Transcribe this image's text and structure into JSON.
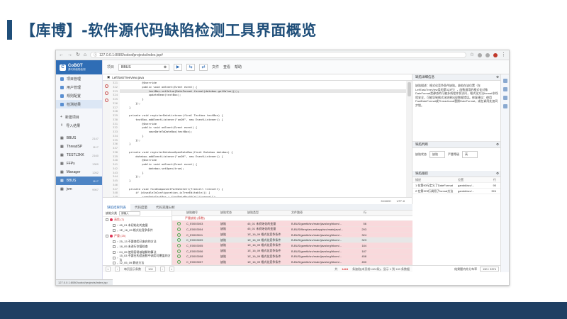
{
  "slide": {
    "title": "【库博】-软件源代码缺陷检测工具界面概览"
  },
  "browser": {
    "url": "127.0.0.1:8080/cobot/projects/index.jsp#",
    "status_url": "127.0.0.1:8080/cobot/projects/index.jsp"
  },
  "sidebar": {
    "logo": "CoBOT",
    "logo_sub": "源代码缺陷检测",
    "menu": [
      {
        "label": "项目管理",
        "active": false
      },
      {
        "label": "用户管理",
        "active": false
      },
      {
        "label": "规则配置",
        "active": false
      },
      {
        "label": "检测结果",
        "active": true
      }
    ],
    "actions": [
      {
        "label": "新建项目"
      },
      {
        "label": "导入结果"
      }
    ],
    "projects": [
      {
        "label": "BBUS",
        "count": "2147",
        "active": false
      },
      {
        "label": "ThreadSP",
        "count": "1117",
        "active": false
      },
      {
        "label": "TESTL2KK",
        "count": "2160",
        "active": false
      },
      {
        "label": "FFPs",
        "count": "1300",
        "active": false
      },
      {
        "label": "Manager",
        "count": "1262",
        "active": false
      },
      {
        "label": "BBUS",
        "count": "1117",
        "active": true
      },
      {
        "label": "jvm",
        "count": "9907",
        "active": false
      }
    ]
  },
  "toolbar": {
    "label": "项目",
    "search_value": "BBUS",
    "menu": [
      "文件",
      "查看",
      "帮助"
    ]
  },
  "editor": {
    "tab": "LeftTaskTreeView.java",
    "status_left": "334/690",
    "status_right": "UTF-8",
    "lines": [
      {
        "n": "321",
        "t": "            @Override",
        "hl": false
      },
      {
        "n": "322",
        "t": "            public void onEvent(Event event) {",
        "hl": false
      },
      {
        "n": "323",
        "t": "                textBox.setValue(DateFormat.format(datebox.getValue()));",
        "hl": true
      },
      {
        "n": "324",
        "t": "                updateBean(textBox);",
        "hl": false
      },
      {
        "n": "325",
        "t": "            }",
        "hl": false
      },
      {
        "n": "326",
        "t": "        });",
        "hl": false
      },
      {
        "n": "327",
        "t": "    }",
        "hl": false
      },
      {
        "n": "328",
        "t": "",
        "hl": false
      },
      {
        "n": "329",
        "t": "    private void registerDateListener(final Textbox textBox) {",
        "hl": false
      },
      {
        "n": "330",
        "t": "        textBox.addEventListener(\"onOK\", new EventListener() {",
        "hl": false
      },
      {
        "n": "331",
        "t": "            @Override",
        "hl": false
      },
      {
        "n": "332",
        "t": "            public void onEvent(Event event) {",
        "hl": false
      },
      {
        "n": "333",
        "t": "                saveDateToDateBox(textBox);",
        "hl": false
      },
      {
        "n": "334",
        "t": "            }",
        "hl": false
      },
      {
        "n": "335",
        "t": "        });",
        "hl": false
      },
      {
        "n": "336",
        "t": "    }",
        "hl": false
      },
      {
        "n": "337",
        "t": "",
        "hl": false
      },
      {
        "n": "338",
        "t": "    private void registerDateboxOpenDateBox(final Datebox datebox) {",
        "hl": false
      },
      {
        "n": "339",
        "t": "        datebox.addEventListener(\"onOK\", new EventListener() {",
        "hl": false
      },
      {
        "n": "340",
        "t": "            @Override",
        "hl": false
      },
      {
        "n": "341",
        "t": "            public void onEvent(Event event) {",
        "hl": false
      },
      {
        "n": "342",
        "t": "                datebox.setOpen(true);",
        "hl": false
      },
      {
        "n": "343",
        "t": "            }",
        "hl": false
      },
      {
        "n": "344",
        "t": "        });",
        "hl": false
      },
      {
        "n": "345",
        "t": "    }",
        "hl": false
      },
      {
        "n": "346",
        "t": "",
        "hl": false
      },
      {
        "n": "347",
        "t": "    private void findComponentForDateCell(Treecell treecell) {",
        "hl": false
      },
      {
        "n": "348",
        "t": "        if (disableInConfiguration.isTreeEditable()) {",
        "hl": false
      },
      {
        "n": "349",
        "t": "            crgeDateTextBox = findDateBoxOfCell(treecell);",
        "hl": false
      }
    ]
  },
  "right_panel": {
    "detail_title": "缺陷详细信息",
    "detail_text": "缺陷描述：格式化竞争条件缺陷。缺陷在该位置（在LeftTaskTreeView类的第323行），函数调用的格式化对象DateFormat是静态的可被多线程并发访问，格式化方法format非线程安全，可能导致格式化结果出现数据错误。修复建议：使用FastDateFormat或ThreadLocal替换DateFormat，或在调用处加同步锁。",
    "mark_title": "缺陷判断",
    "mark_label": "缺陷状态",
    "mark_value": "缺陷",
    "sev_label": "严重等级",
    "sev_value": "高",
    "trace_title": "缺陷跟踪",
    "trace_headers": [
      "描述",
      "位置",
      "行"
    ],
    "trace_rows": [
      {
        "desc": "1 在第90行定义了DateFormat",
        "loc": "gambk/src/...",
        "line": "90"
      },
      {
        "desc": "2 在第323行调用了format方法",
        "loc": "gambk/src/...",
        "line": "324"
      }
    ],
    "foot_label": "结果题内外分布率",
    "foot_value": "150 / 3374"
  },
  "bottom": {
    "tabs": [
      "缺陷结果列表",
      "代码度量",
      "代码克隆分析"
    ],
    "tree_header": "缺陷分类",
    "tree_filter": "请输入",
    "tree": [
      {
        "label": "高危 (7)",
        "level": 1
      },
      {
        "label": "45_01 未初始化的变量",
        "level": 2
      },
      {
        "label": "1E_16_09 格式化竞争条件",
        "level": 2
      },
      {
        "label": "严重 (25)",
        "level": 1
      },
      {
        "label": "25_13 不要使用已废弃的方法",
        "level": 2
      },
      {
        "label": "18_05 未进行空值检查",
        "level": 2
      },
      {
        "label": "04_05 使用容易被破解的算法",
        "level": 2
      },
      {
        "label": "15_03 不要在构造函数中调用可覆盖的方法",
        "level": 2
      },
      {
        "label": "12_05_09 静态方法",
        "level": 2
      },
      {
        "label": "中等 (133)",
        "level": 1
      }
    ],
    "grid_headers": [
      "缺陷编号",
      "缺陷状态",
      "缺陷类型",
      "文件路径",
      "行"
    ],
    "grid_group": "严重缺陷 (条数)",
    "grid_rows": [
      {
        "id": "C_E0003003",
        "st": "缺陷",
        "type": "45_01 未初始化的变量",
        "path": "B-BUS/gamtk/src/main/java/org/bkom/...",
        "line": "56",
        "sel": false
      },
      {
        "id": "C_E0003004",
        "st": "缺陷",
        "type": "45_01 未初始化的变量",
        "path": "B-BUS/fibroplan-webapp/src/main/java/...",
        "line": "293",
        "sel": false
      },
      {
        "id": "C_E0003011",
        "st": "缺陷",
        "type": "1E_16_09 格式化竞争条件",
        "path": "B-BUS/gamtk/src/main/java/org/bkom/...",
        "line": "324",
        "sel": false
      },
      {
        "id": "C_E0003009",
        "st": "缺陷",
        "type": "1E_16_09 格式化竞争条件",
        "path": "B-BUS/gamtk/src/main/java/org/bkom/...",
        "line": "323",
        "sel": true
      },
      {
        "id": "C_E0003005",
        "st": "缺陷",
        "type": "1E_16_09 格式化竞争条件",
        "path": "B-BUS/gamtk/src/main/java/org/bkom/...",
        "line": "184",
        "sel": false
      },
      {
        "id": "C_E0003006",
        "st": "缺陷",
        "type": "1E_16_09 格式化竞争条件",
        "path": "B-BUS/gamtk/src/main/java/org/bkom/...",
        "line": "187",
        "sel": false
      },
      {
        "id": "C_E0003008",
        "st": "缺陷",
        "type": "1E_16_09 格式化竞争条件",
        "path": "B-BUS/gamtk/src/main/java/org/bkom/...",
        "line": "458",
        "sel": false
      },
      {
        "id": "C_E0003007",
        "st": "缺陷",
        "type": "1E_16_09 格式化竞争条件",
        "path": "B-BUS/gamtk/src/main/java/org/bkom/...",
        "line": "450",
        "sel": false
      },
      {
        "id": "C_E0003010",
        "st": "缺陷",
        "type": "1E_16_09 格式化竞争条件",
        "path": "B-BUS/fibroplan-webapp/src/main/java/...",
        "line": "181",
        "sel": false
      }
    ],
    "status_pagesize_label": "每页显示条数",
    "status_pagesize": "100",
    "status_total_prefix": "共",
    "status_total": "1424",
    "status_total_suffix": "条缺陷(本页前1424条)，显示 1 到 100 条数据"
  }
}
